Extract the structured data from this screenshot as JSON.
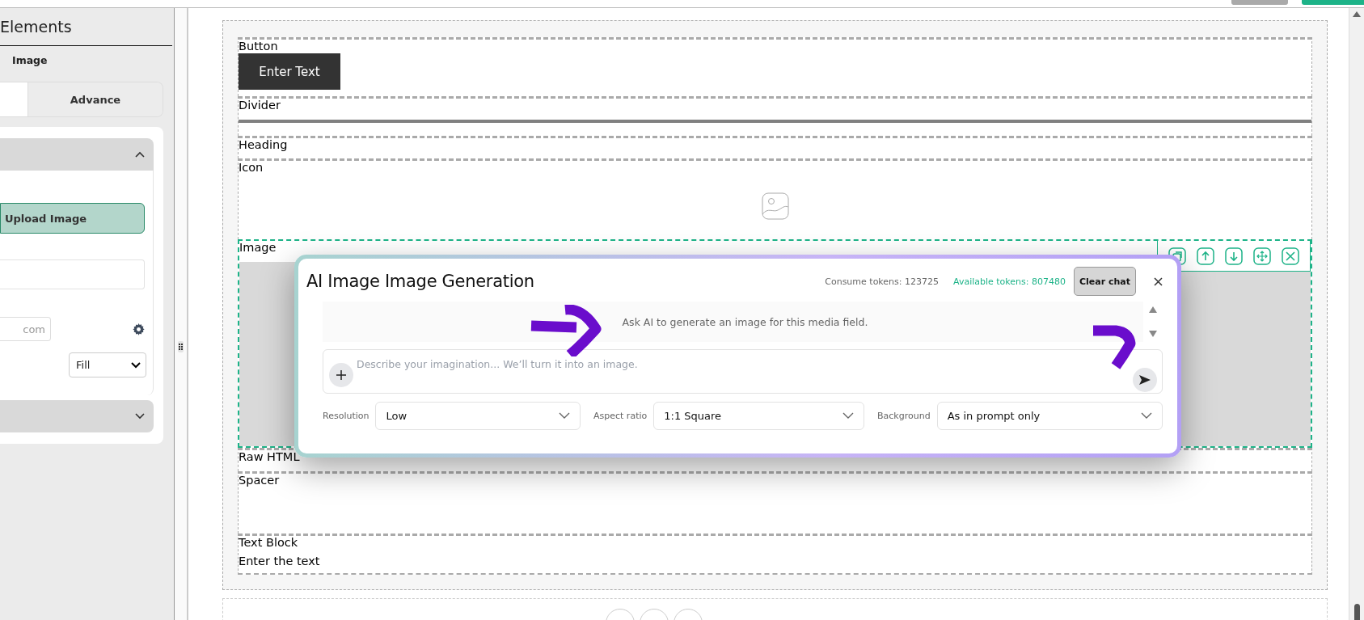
{
  "sidebar": {
    "title": "Elements",
    "breadcrumb": "Image",
    "tabs": [
      {
        "selected": true
      },
      {
        "label": "Advance",
        "selected": false
      }
    ],
    "sections": [
      {
        "expanded": true,
        "upload_button": "Upload Image",
        "url_field": {
          "placeholder": "com"
        },
        "fit_select": {
          "value": "Fill"
        }
      },
      {
        "expanded": false
      }
    ]
  },
  "canvas": {
    "elements": [
      {
        "kind": "button",
        "label": "Button",
        "text": "Enter Text",
        "selected": false
      },
      {
        "kind": "divider",
        "label": "Divider",
        "selected": false
      },
      {
        "kind": "heading",
        "label": "Heading",
        "selected": false
      },
      {
        "kind": "icon",
        "label": "Icon",
        "selected": false
      },
      {
        "kind": "image",
        "label": "Image",
        "selected": true
      },
      {
        "kind": "raw_html",
        "label": "Raw HTML",
        "selected": false
      },
      {
        "kind": "spacer",
        "label": "Spacer",
        "selected": false
      },
      {
        "kind": "text",
        "label": "Text Block",
        "text": "Enter the text",
        "selected": false
      }
    ]
  },
  "modal": {
    "title": "AI Image Image Generation",
    "consume_tokens": "Consume tokens: 123725",
    "available_tokens": "Available tokens: 807480",
    "clear_button": "Clear chat",
    "message": "Ask AI to generate an image for this media field.",
    "prompt": {
      "placeholder": "Describe your imagination... We’ll turn it into an image."
    },
    "options": [
      {
        "label": "Resolution",
        "value": "Low"
      },
      {
        "label": "Aspect ratio",
        "value": "1:1 Square"
      },
      {
        "label": "Background",
        "value": "As in prompt only"
      }
    ]
  }
}
